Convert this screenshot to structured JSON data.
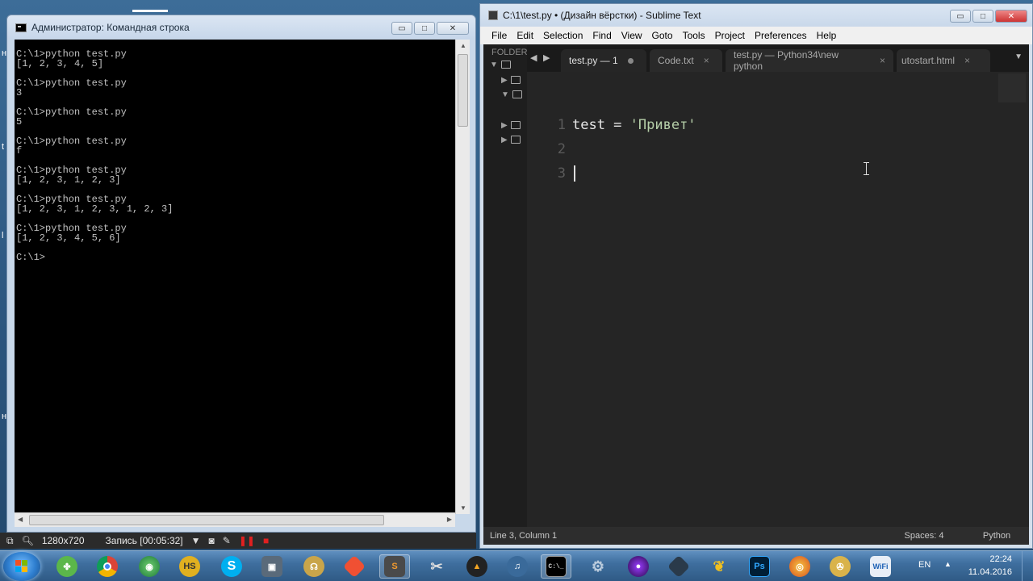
{
  "cmd_window": {
    "title": "Администратор: Командная строка",
    "buttons": {
      "minimize": "▭",
      "maximize": "□",
      "close": "✕"
    },
    "output": "C:\\1>python test.py\n[1, 2, 3, 4, 5]\n\nC:\\1>python test.py\n3\n\nC:\\1>python test.py\n5\n\nC:\\1>python test.py\nf\n\nC:\\1>python test.py\n[1, 2, 3, 1, 2, 3]\n\nC:\\1>python test.py\n[1, 2, 3, 1, 2, 3, 1, 2, 3]\n\nC:\\1>python test.py\n[1, 2, 3, 4, 5, 6]\n\nC:\\1>"
  },
  "sublime": {
    "title": "C:\\1\\test.py • (Дизайн вёрстки) - Sublime Text",
    "menu": [
      "File",
      "Edit",
      "Selection",
      "Find",
      "View",
      "Goto",
      "Tools",
      "Project",
      "Preferences",
      "Help"
    ],
    "sidebar_label": "FOLDER",
    "tabs": [
      {
        "label": "test.py — 1",
        "active": true,
        "modified": true
      },
      {
        "label": "Code.txt",
        "active": false
      },
      {
        "label": "test.py — Python34\\new python",
        "active": false
      },
      {
        "label": "utostart.html",
        "active": false
      }
    ],
    "tab_close": "×",
    "code": {
      "line_numbers": [
        "1",
        "2",
        "3"
      ],
      "line1_prefix": "test = ",
      "line1_string": "'Привет'"
    },
    "status": {
      "position": "Line 3, Column 1",
      "spaces": "Spaces: 4",
      "syntax": "Python"
    }
  },
  "recorder": {
    "resolution": "1280x720",
    "status": "Запись [00:05:32]"
  },
  "taskbar": {
    "icons": [
      "windows-start",
      "clover",
      "chrome",
      "web-globe",
      "hs",
      "skype",
      "tool-bag",
      "router",
      "git",
      "sublime",
      "scissors",
      "a-app",
      "audio",
      "cmd",
      "gear-app",
      "obs",
      "cube",
      "pineapple",
      "photoshop",
      "firefox-like",
      "gold-reel",
      "wifi"
    ],
    "hs_label": "HS",
    "ps_label": "Ps",
    "cmd_label": "C:\\_",
    "wifi_label": "WiFi",
    "skype_label": "S",
    "lang": "EN",
    "time": "22:24",
    "date": "11.04.2016"
  },
  "colors": {
    "code_bg": "#252525",
    "string": "#b5cea8",
    "cmd_bg": "#000000"
  }
}
